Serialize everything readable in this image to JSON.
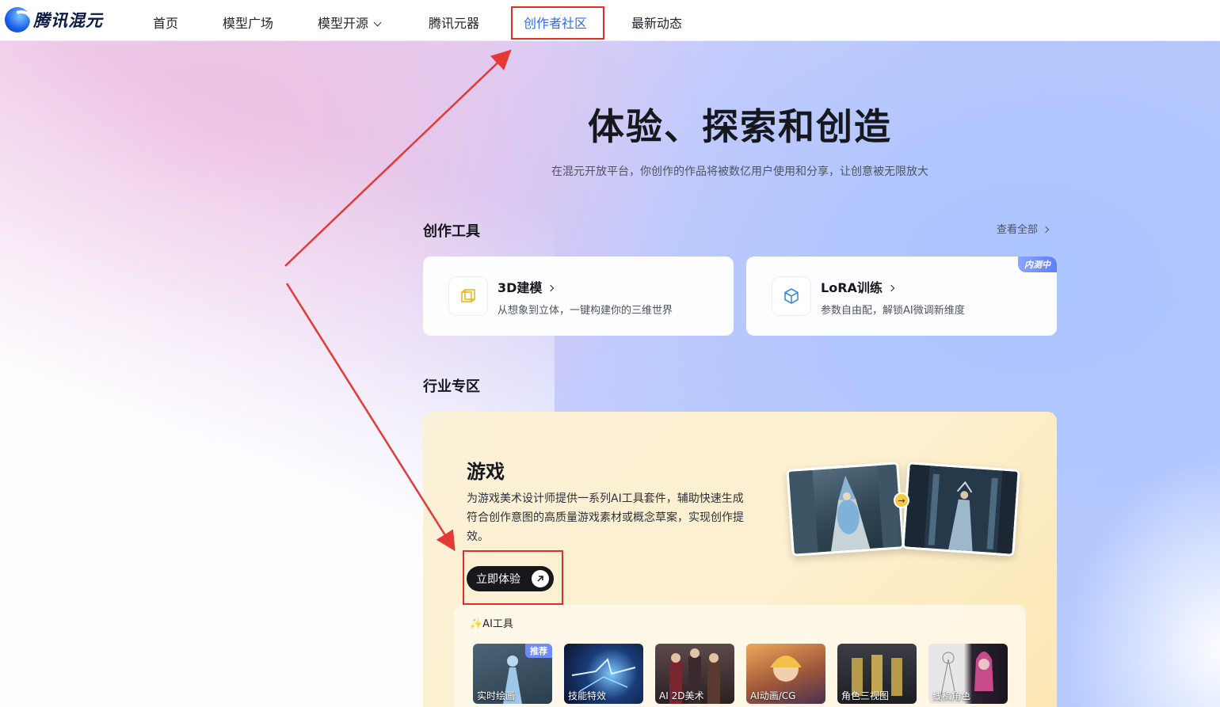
{
  "header": {
    "logo_text": "腾讯混元",
    "nav": [
      {
        "label": "首页"
      },
      {
        "label": "模型广场"
      },
      {
        "label": "模型开源"
      },
      {
        "label": "腾讯元器"
      },
      {
        "label": "创作者社区"
      },
      {
        "label": "最新动态"
      }
    ],
    "active_nav": "创作者社区"
  },
  "hero": {
    "title": "体验、探索和创造",
    "subtitle": "在混元开放平台，你创作的作品将被数亿用户使用和分享，让创意被无限放大"
  },
  "tools": {
    "title": "创作工具",
    "view_all": "查看全部",
    "cards": [
      {
        "name": "3D建模",
        "desc": "从想象到立体，一键构建你的三维世界",
        "icon": "cube-wireframe-icon"
      },
      {
        "name": "LoRA训练",
        "desc": "参数自由配，解锁AI微调新维度",
        "icon": "box-icon",
        "badge": "内测中"
      }
    ]
  },
  "industry": {
    "title": "行业专区",
    "game": {
      "title": "游戏",
      "desc": "为游戏美术设计师提供一系列AI工具套件，辅助快速生成符合创作意图的高质量游戏素材或概念草案，实现创作提效。",
      "button": "立即体验"
    },
    "ai_tools": {
      "label": "✨AI工具",
      "items": [
        {
          "label": "实时绘画",
          "badge": "推荐"
        },
        {
          "label": "技能特效"
        },
        {
          "label": "AI 2D美术"
        },
        {
          "label": "AI动画/CG"
        },
        {
          "label": "角色三视图"
        },
        {
          "label": "线稿角色"
        }
      ]
    }
  },
  "colors": {
    "accent": "#2e6bf0",
    "highlight_box": "#e02c2c",
    "button_dark": "#17181b",
    "badge": "#6d8dff"
  }
}
